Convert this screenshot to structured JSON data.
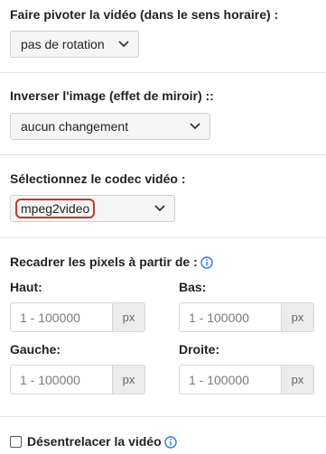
{
  "rotate": {
    "label": "Faire pivoter la vidéo (dans le sens horaire) :",
    "value": "pas de rotation"
  },
  "mirror": {
    "label": "Inverser l'image (effet de miroir) ::",
    "value": "aucun changement"
  },
  "codec": {
    "label": "Sélectionnez le codec vidéo :",
    "value": "mpeg2video"
  },
  "crop": {
    "label": "Recadrer les pixels à partir de :",
    "top": {
      "label": "Haut:",
      "placeholder": "1 - 100000",
      "unit": "px"
    },
    "bottom": {
      "label": "Bas:",
      "placeholder": "1 - 100000",
      "unit": "px"
    },
    "left": {
      "label": "Gauche:",
      "placeholder": "1 - 100000",
      "unit": "px"
    },
    "right": {
      "label": "Droite:",
      "placeholder": "1 - 100000",
      "unit": "px"
    }
  },
  "deinterlace": {
    "label": "Désentrelacer la vidéo",
    "checked": false
  },
  "colors": {
    "info": "#2a7ae2",
    "highlight": "#c0392b"
  }
}
